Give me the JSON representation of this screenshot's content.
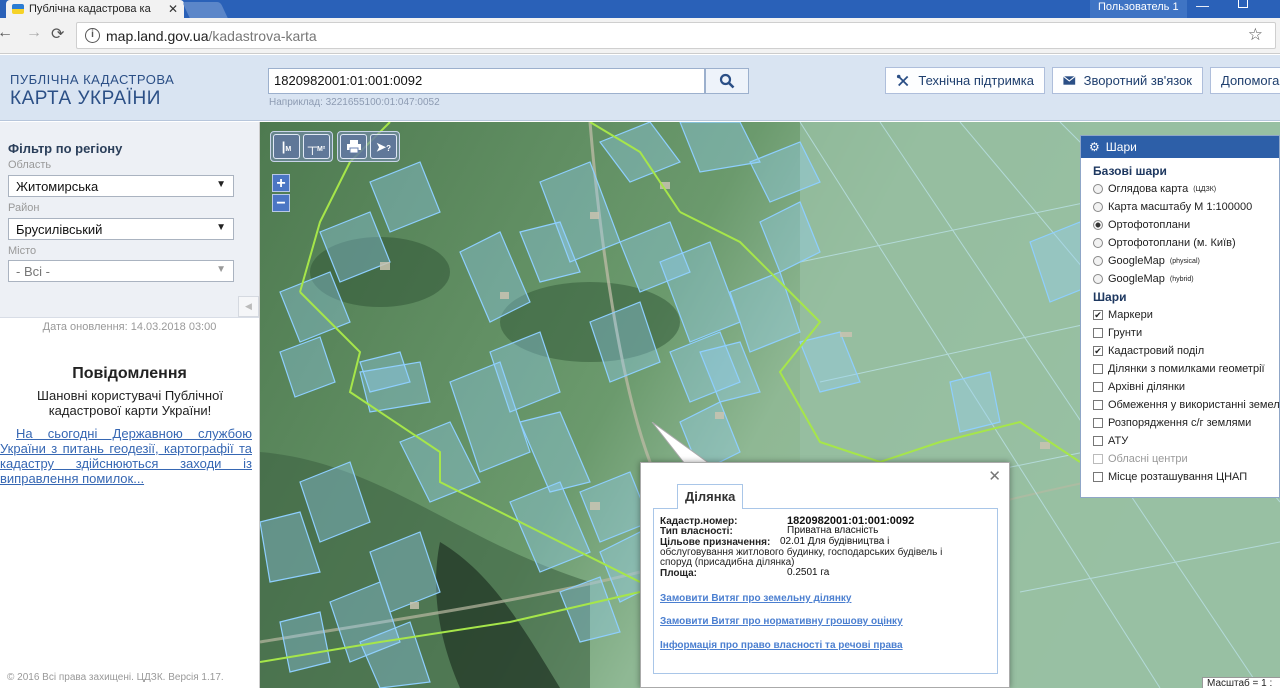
{
  "browser": {
    "tab_title": "Публічна кадастрова ка",
    "user": "Пользователь 1",
    "url_host": "map.land.gov.ua",
    "url_path": "/kadastrova-karta"
  },
  "header": {
    "logo_line1": "ПУБЛІЧНА КАДАСТРОВА",
    "logo_line2": "КАРТА УКРАЇНИ",
    "search_value": "1820982001:01:001:0092",
    "search_hint": "Наприклад: 3221655100:01:047:0052",
    "support_label": "Технічна підтримка",
    "feedback_label": "Зворотний зв'язок",
    "help_label": "Допомога"
  },
  "sidebar": {
    "filter_title": "Фільтр по регіону",
    "oblast_label": "Область",
    "oblast_value": "Житомирська",
    "rayon_label": "Район",
    "rayon_value": "Брусилівський",
    "city_label": "Місто",
    "city_value": "- Всі -",
    "update_date": "Дата оновлення: 14.03.2018 03:00",
    "notice_title": "Повідомлення",
    "notice_text": "Шановні користувачі Публічної кадастрової карти України!",
    "notice_link": "На сьогодні Державною службою України з питань геодезії, картографії та кадастру здійснюються заходи із виправлення помилок...",
    "copyright": "© 2016 Всі права захищені. ЦДЗК. Версія 1.17."
  },
  "map_toolbar": {
    "measure_line": "М",
    "measure_area": "М²"
  },
  "layers": {
    "title": "Шари",
    "base_title": "Базові шари",
    "base": [
      {
        "label": "Оглядова карта",
        "sup": "(ЦДЗК)",
        "selected": false
      },
      {
        "label": "Карта масштабу М 1:100000",
        "sup": "",
        "selected": false
      },
      {
        "label": "Ортофотоплани",
        "sup": "",
        "selected": true
      },
      {
        "label": "Ортофотоплани (м. Київ)",
        "sup": "",
        "selected": false
      },
      {
        "label": "GoogleMap",
        "sup": "(physical)",
        "selected": false
      },
      {
        "label": "GoogleMap",
        "sup": "(hybrid)",
        "selected": false
      }
    ],
    "overlay_title": "Шари",
    "overlays": [
      {
        "label": "Маркери",
        "checked": true,
        "disabled": false
      },
      {
        "label": "Грунти",
        "checked": false,
        "disabled": false
      },
      {
        "label": "Кадастровий поділ",
        "checked": true,
        "disabled": false
      },
      {
        "label": "Ділянки з помилками геометрії",
        "checked": false,
        "disabled": false
      },
      {
        "label": "Архівні ділянки",
        "checked": false,
        "disabled": false
      },
      {
        "label": "Обмеження у використанні земель",
        "checked": false,
        "disabled": false
      },
      {
        "label": "Розпорядження с/г землями",
        "checked": false,
        "disabled": false
      },
      {
        "label": "АТУ",
        "checked": false,
        "disabled": false
      },
      {
        "label": "Обласні центри",
        "checked": false,
        "disabled": true
      },
      {
        "label": "Місце розташування ЦНАП",
        "checked": false,
        "disabled": false
      }
    ]
  },
  "popup": {
    "tab": "Ділянка",
    "cad_label": "Кадастр.номер:",
    "cad_value": "1820982001:01:001:0092",
    "own_label": "Тип власності:",
    "own_value": "Приватна власність",
    "purpose_label": "Цільове призначення:",
    "purpose_value": "02.01 Для будівництва і",
    "purpose_cont1": "обслуговування житлового будинку, господарських будівель і",
    "purpose_cont2": "споруд (присадибна ділянка)",
    "area_label": "Площа:",
    "area_value": "0.2501 га",
    "link1": "Замовити Витяг про земельну ділянку",
    "link2": "Замовити Витяг про нормативну грошову оцінку",
    "link3": "Інформація про право власності та речові права"
  },
  "scale_label": "Масштаб = 1 :",
  "colors": {
    "header_bg": "#d9e4f2",
    "brand": "#2b4f86",
    "parcel": "#8ecfff",
    "boundary": "#a6e64a",
    "layers_head": "#2d5fa8"
  }
}
